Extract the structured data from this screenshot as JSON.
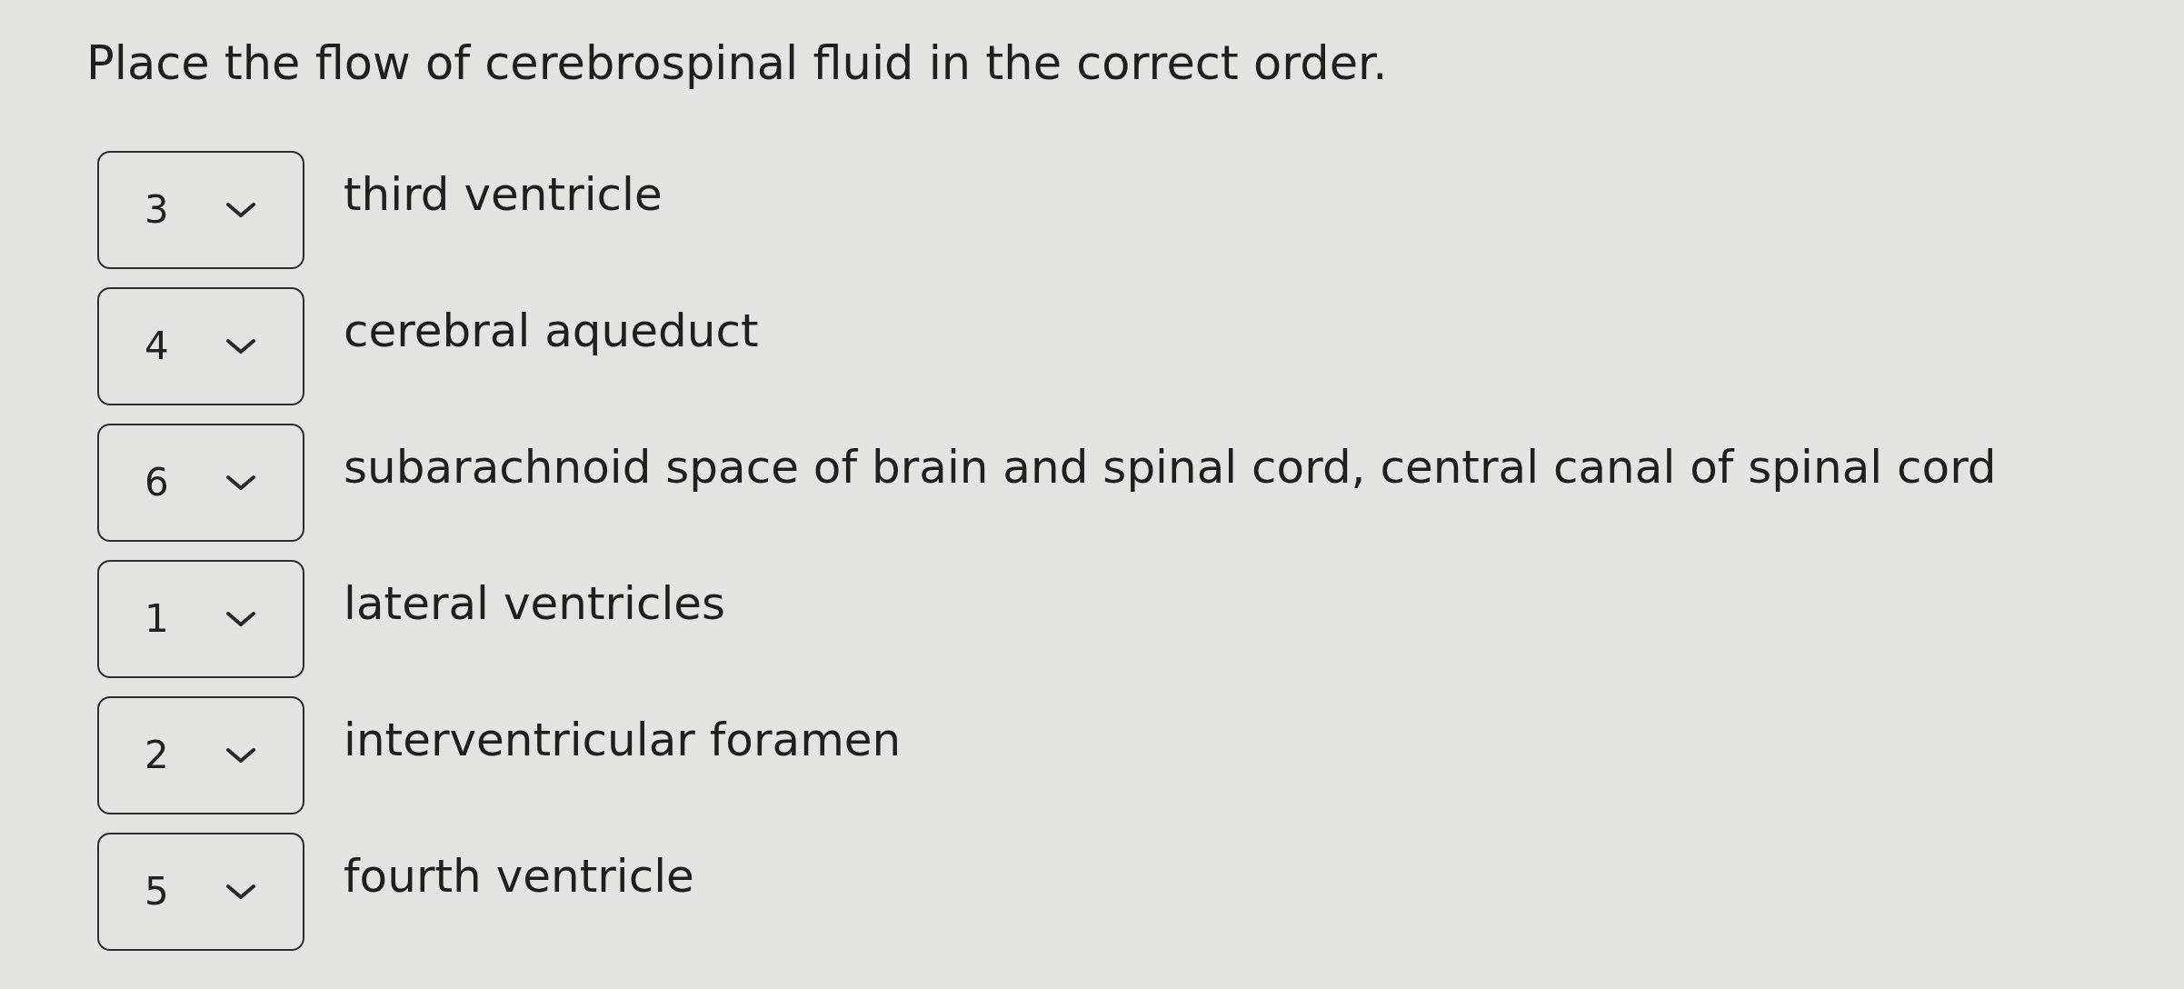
{
  "question": {
    "text": "Place the flow of cerebrospinal fluid in the correct order."
  },
  "items": [
    {
      "value": "3",
      "label": "third ventricle"
    },
    {
      "value": "4",
      "label": "cerebral aqueduct"
    },
    {
      "value": "6",
      "label": "subarachnoid space of brain and spinal cord, central canal of spinal cord"
    },
    {
      "value": "1",
      "label": "lateral ventricles"
    },
    {
      "value": "2",
      "label": "interventricular foramen"
    },
    {
      "value": "5",
      "label": "fourth ventricle"
    }
  ]
}
